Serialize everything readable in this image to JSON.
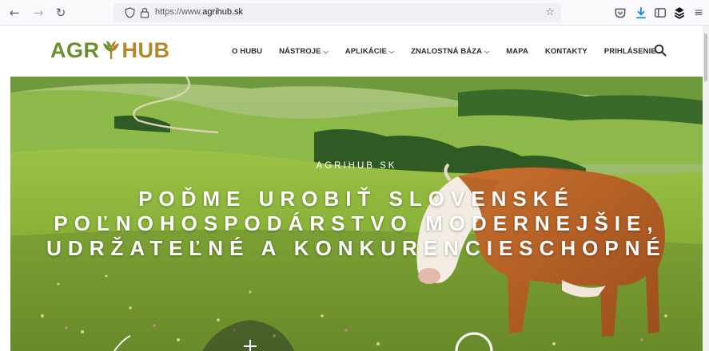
{
  "browser": {
    "url_prefix": "https://www.",
    "url_domain": "agrihub.sk",
    "back_icon": "arrow-left-icon",
    "forward_icon": "arrow-right-icon",
    "reload_icon": "reload-icon",
    "shield_icon": "shield-icon",
    "lock_icon": "lock-icon",
    "bookmark_icon": "star-icon",
    "pocket_icon": "pocket-icon",
    "download_icon": "download-icon",
    "sidebar_icon": "sidebar-icon",
    "extension_icon": "extension-icon",
    "menu_icon": "hamburger-menu-icon"
  },
  "logo": {
    "part1": "AGR",
    "part2": "HUB",
    "green": "#6a8f2e",
    "gold": "#b08a2a"
  },
  "nav": {
    "items": [
      {
        "label": "O HUBU",
        "dropdown": false
      },
      {
        "label": "NÁSTROJE",
        "dropdown": true
      },
      {
        "label": "APLIKÁCIE",
        "dropdown": true
      },
      {
        "label": "ZNALOSTNÁ BÁZA",
        "dropdown": true
      },
      {
        "label": "MAPA",
        "dropdown": false
      },
      {
        "label": "KONTAKTY",
        "dropdown": false
      },
      {
        "label": "PRIHLÁSENIE",
        "dropdown": false
      }
    ],
    "search_icon": "search-icon"
  },
  "hero": {
    "kicker": "AGRIHUB SK",
    "headline_line1": "POĎME UROBIŤ SLOVENSKÉ",
    "headline_line2": "POĽNOHOSPODÁRSTVO MODERNEJŠIE,",
    "headline_line3": "UDRŽATEĽNÉ A KONKURENCIESCHOPNÉ"
  }
}
